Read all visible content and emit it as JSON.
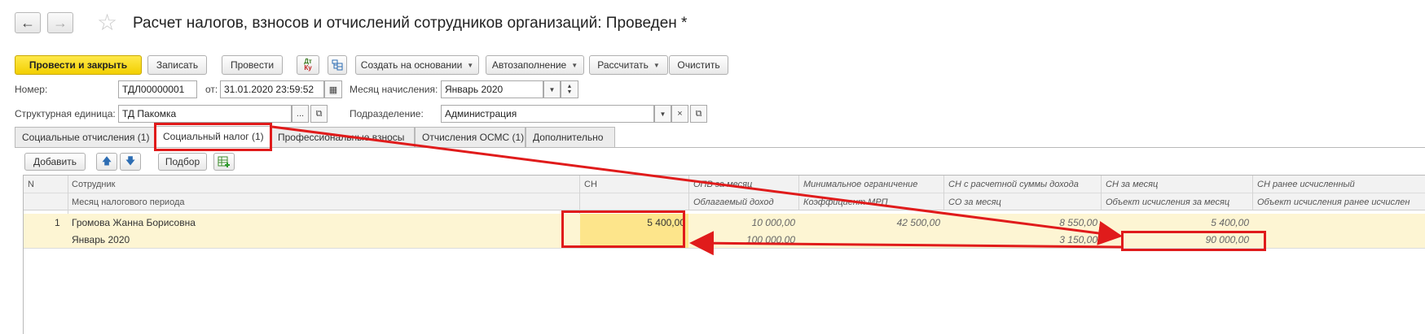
{
  "window": {
    "title": "Расчет налогов, взносов и отчислений сотрудников организаций: Проведен *"
  },
  "toolbar": {
    "post_close": "Провести и закрыть",
    "save": "Записать",
    "post": "Провести",
    "dt_kt": "Дт\nКу",
    "create_based": "Создать на основании",
    "autofill": "Автозаполнение",
    "calculate": "Рассчитать",
    "clear": "Очистить"
  },
  "form": {
    "number_label": "Номер:",
    "number_value": "ТДЛ00000001",
    "date_label": "от:",
    "date_value": "31.01.2020 23:59:52",
    "month_label": "Месяц начисления:",
    "month_value": "Январь 2020",
    "unit_label": "Структурная единица:",
    "unit_value": "ТД Пакомка",
    "division_label": "Подразделение:",
    "division_value": "Администрация"
  },
  "tabs": [
    {
      "label": "Социальные отчисления (1)"
    },
    {
      "label": "Социальный налог (1)"
    },
    {
      "label": "Профессиональные взносы"
    },
    {
      "label": "Отчисления ОСМС (1)"
    },
    {
      "label": "Дополнительно"
    }
  ],
  "grid_toolbar": {
    "add": "Добавить",
    "select": "Подбор"
  },
  "grid": {
    "headers": {
      "n": "N",
      "employee": "Сотрудник",
      "period": "Месяц налогового периода",
      "sn": "СН",
      "opv": "ОПВ за месяц",
      "taxable": "Облагаемый доход",
      "min_limit": "Минимальное ограничение",
      "mrp_coef": "Коэффициент МРП",
      "sn_calc": "СН с расчетной суммы дохода",
      "so_month": "СО за месяц",
      "sn_month": "СН за месяц",
      "object_month": "Объект исчисления за месяц",
      "sn_prev": "СН ранее исчисленный",
      "object_prev": "Объект исчисления ранее исчислен"
    },
    "rows": [
      {
        "n": "1",
        "employee": "Громова Жанна Борисовна",
        "period": "Январь 2020",
        "sn": "5 400,00",
        "opv": "10 000,00",
        "taxable": "100 000,00",
        "min_limit": "42 500,00",
        "sn_calc": "8 550,00",
        "so_month": "3 150,00",
        "sn_month": "5 400,00",
        "object_month": "90 000,00"
      }
    ]
  },
  "colors": {
    "highlight_row": "#fdf5d3",
    "active_cell": "#fde58b",
    "annotation": "#e01b1b"
  }
}
